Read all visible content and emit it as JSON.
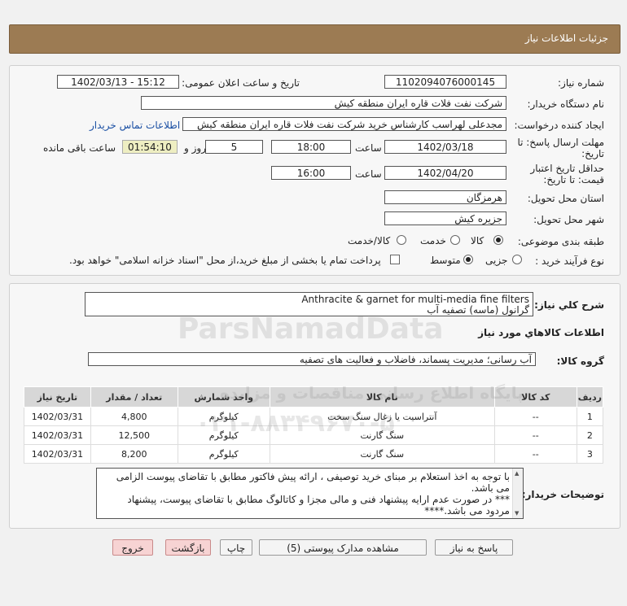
{
  "header": {
    "title": "جزئیات اطلاعات نیاز"
  },
  "form": {
    "need_number_label": "شماره نیاز:",
    "need_number": "1102094076000145",
    "announce_label": "تاریخ و ساعت اعلان عمومی:",
    "announce_value": "1402/03/13 - 15:12",
    "buyer_label": "نام دستگاه خریدار:",
    "buyer_value": "شرکت نفت فلات قاره ایران منطقه کیش",
    "creator_label": "ایجاد کننده درخواست:",
    "creator_value": "مجدعلی لهراسب کارشناس خرید شرکت نفت فلات قاره ایران منطقه کیش",
    "contact_link": "اطلاعات تماس خریدار",
    "deadline_label_1": "مهلت ارسال پاسخ: تا",
    "deadline_label_2": "تاریخ:",
    "deadline_date": "1402/03/18",
    "time_label": "ساعت",
    "deadline_time": "18:00",
    "days_value": "5",
    "days_label": "روز و",
    "remaining_time": "01:54:10",
    "remaining_label": "ساعت باقی مانده",
    "validity_label_1": "حداقل تاریخ اعتبار",
    "validity_label_2": "قیمت: تا تاریخ:",
    "validity_date": "1402/04/20",
    "validity_time_label": "ساعت",
    "validity_time": "16:00",
    "province_label": "استان محل تحویل:",
    "province_value": "هرمزگان",
    "city_label": "شهر محل تحویل:",
    "city_value": "جزیره کیش",
    "category_label": "طبقه بندی موضوعی:",
    "category_options": [
      "کالا",
      "خدمت",
      "کالا/خدمت"
    ],
    "process_label": "نوع فرآیند خرید :",
    "process_options": [
      "جزیی",
      "متوسط"
    ],
    "payment_note": "پرداخت تمام یا بخشی از مبلغ خرید،از محل \"اسناد خزانه اسلامی\" خواهد بود."
  },
  "details": {
    "summary_label": "شرح کلي نياز:",
    "summary_line1": "Anthracite & garnet for multi-media fine filters",
    "summary_line2": "گرانول (ماسه) تصفیه آب",
    "goods_info_title": "اطلاعات كالاهاي مورد نياز",
    "group_label": "گروه کالا:",
    "group_value": "آب رسانی؛ مدیریت پسماند، فاضلاب و فعالیت های تصفیه",
    "table": {
      "headers": [
        "ردیف",
        "کد کالا",
        "نام کالا",
        "واحد شمارش",
        "تعداد / مقدار",
        "تاریخ نیاز"
      ],
      "rows": [
        [
          "1",
          "--",
          "آنتراسیت یا زغال سنگ سخت",
          "کیلوگرم",
          "4,800",
          "1402/03/31"
        ],
        [
          "2",
          "--",
          "سنگ گارنت",
          "کیلوگرم",
          "12,500",
          "1402/03/31"
        ],
        [
          "3",
          "--",
          "سنگ گارنت",
          "کیلوگرم",
          "8,200",
          "1402/03/31"
        ]
      ]
    },
    "buyer_notes_label": "توضیحات خریدار:",
    "buyer_notes_line1": "با توجه به اخذ استعلام بر مبنای خرید توصیفی ، ارائه پیش فاکتور مطابق با تقاضای پیوست الزامی",
    "buyer_notes_line2": "می باشد.",
    "buyer_notes_line3": "*** در صورت عدم ارایه پیشنهاد فنی و مالی مجزا و کاتالوگ مطابق با تقاضای پیوست، پیشنهاد",
    "buyer_notes_line4": "مردود می باشد.****"
  },
  "buttons": {
    "reply": "پاسخ به نیاز",
    "attachments": "مشاهده مدارک پیوستی (5)",
    "print": "چاپ",
    "back": "بازگشت",
    "exit": "خروج"
  },
  "watermark": {
    "brand": "ParsNamadData",
    "phone": "۰۲۱-۸۸۳۴۹۶۷۰-۵",
    "site_text": "پایگاه اطلاع رسانی مناقصات و مزایده"
  }
}
